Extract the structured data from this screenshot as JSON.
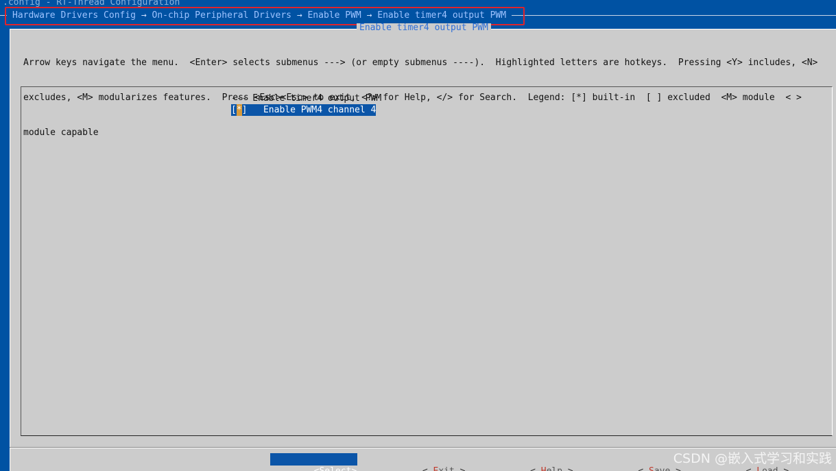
{
  "window": {
    "config_title": ".config - RT-Thread Configuration"
  },
  "breadcrumb": {
    "items": [
      "Hardware Drivers Config",
      "On-chip Peripheral Drivers",
      "Enable PWM",
      "Enable timer4 output PWM"
    ],
    "separator": " → "
  },
  "dialog": {
    "title": "Enable timer4 output PWM",
    "help_lines": [
      "Arrow keys navigate the menu.  <Enter> selects submenus ---> (or empty submenus ----).  Highlighted letters are hotkeys.  Pressing <Y> includes, <N>",
      "excludes, <M> modularizes features.  Press <Esc><Esc> to exit, <?> for Help, </> for Search.  Legend: [*] built-in  [ ] excluded  <M> module  < >",
      "module capable"
    ]
  },
  "menu": {
    "header": "--- Enable timer4 output PWM",
    "items": [
      {
        "bracket_open": "[",
        "mark": "*",
        "bracket_close": "]",
        "label": "   Enable PWM4 channel 4",
        "selected": true
      }
    ]
  },
  "buttons": [
    {
      "open": "<",
      "hot": "S",
      "rest": "elect",
      "close": ">",
      "selected": true
    },
    {
      "open": "< ",
      "hot": "E",
      "rest": "xit",
      "close": " >",
      "selected": false
    },
    {
      "open": "< ",
      "hot": "H",
      "rest": "elp",
      "close": " >",
      "selected": false
    },
    {
      "open": "< ",
      "hot": "S",
      "rest": "ave",
      "close": " >",
      "selected": false
    },
    {
      "open": "< ",
      "hot": "L",
      "rest": "oad",
      "close": " >",
      "selected": false
    }
  ],
  "watermark": "CSDN @嵌入式学习和实践",
  "colors": {
    "background": "#0052a3",
    "dialog": "#cccccc",
    "selection": "#0b55a8",
    "hotkey": "#c0392b",
    "annotation_box": "#e0242c",
    "breadcrumb_text": "#9ec3ff"
  }
}
